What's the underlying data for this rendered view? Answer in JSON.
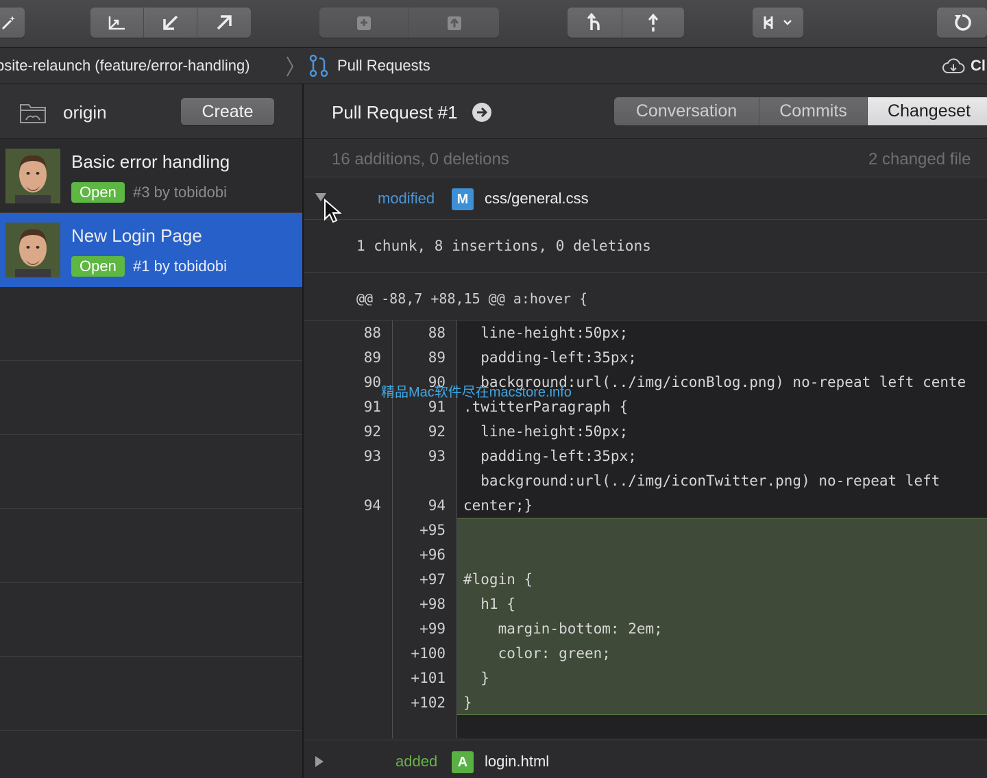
{
  "toolbar": {
    "buttons": [
      "magic-icon",
      "fetch-icon",
      "pull-icon",
      "push-icon",
      "stash-icon",
      "pop-icon",
      "branch-icon",
      "merge-icon",
      "compare-icon",
      "refresh-icon"
    ]
  },
  "breadcrumb": {
    "repo": "bsite-relaunch (feature/error-handling)",
    "section": "Pull Requests",
    "cloud_label": "Cl"
  },
  "sidebar": {
    "remote": "origin",
    "create_label": "Create",
    "pull_requests": [
      {
        "title": "Basic error handling",
        "status": "Open",
        "meta": "#3 by tobidobi"
      },
      {
        "title": "New Login Page",
        "status": "Open",
        "meta": "#1 by tobidobi"
      }
    ]
  },
  "main": {
    "title": "Pull Request #1",
    "tabs": [
      "Conversation",
      "Commits",
      "Changeset"
    ],
    "active_tab": "Changeset",
    "stats": "16 additions, 0 deletions",
    "changed_files": "2 changed file",
    "files": [
      {
        "status": "modified",
        "tag": "M",
        "name": "css/general.css"
      },
      {
        "status": "added",
        "tag": "A",
        "name": "login.html"
      }
    ],
    "chunk_summary": "1 chunk, 8 insertions, 0 deletions",
    "hunk_header": "@@ -88,7 +88,15 @@ a:hover {"
  },
  "diff_lines": [
    {
      "old": "88",
      "new": "88",
      "code": "  line-height:50px;"
    },
    {
      "old": "89",
      "new": "89",
      "code": "  padding-left:35px;"
    },
    {
      "old": "90",
      "new": "90",
      "code": "  background:url(../img/iconBlog.png) no-repeat left cente"
    },
    {
      "old": "91",
      "new": "91",
      "code": ".twitterParagraph {"
    },
    {
      "old": "92",
      "new": "92",
      "code": "  line-height:50px;"
    },
    {
      "old": "93",
      "new": "93",
      "code": "  padding-left:35px;"
    },
    {
      "old": "",
      "new": "",
      "code": "  background:url(../img/iconTwitter.png) no-repeat left"
    },
    {
      "old": "94",
      "new": "94",
      "code": "center;}"
    },
    {
      "old": "",
      "new": "+95",
      "code": ""
    },
    {
      "old": "",
      "new": "+96",
      "code": ""
    },
    {
      "old": "",
      "new": "+97",
      "code": "#login {"
    },
    {
      "old": "",
      "new": "+98",
      "code": "  h1 {"
    },
    {
      "old": "",
      "new": "+99",
      "code": "    margin-bottom: 2em;"
    },
    {
      "old": "",
      "new": "+100",
      "code": "    color: green;"
    },
    {
      "old": "",
      "new": "+101",
      "code": "  }"
    },
    {
      "old": "",
      "new": "+102",
      "code": "}"
    }
  ],
  "watermark": "精品Mac软件尽在macstore.info",
  "colors": {
    "selection": "#2860c9",
    "open_badge": "#5db742",
    "modified": "#4b95d9",
    "added": "#6ab04c",
    "added_bg": "#3f4a38"
  }
}
